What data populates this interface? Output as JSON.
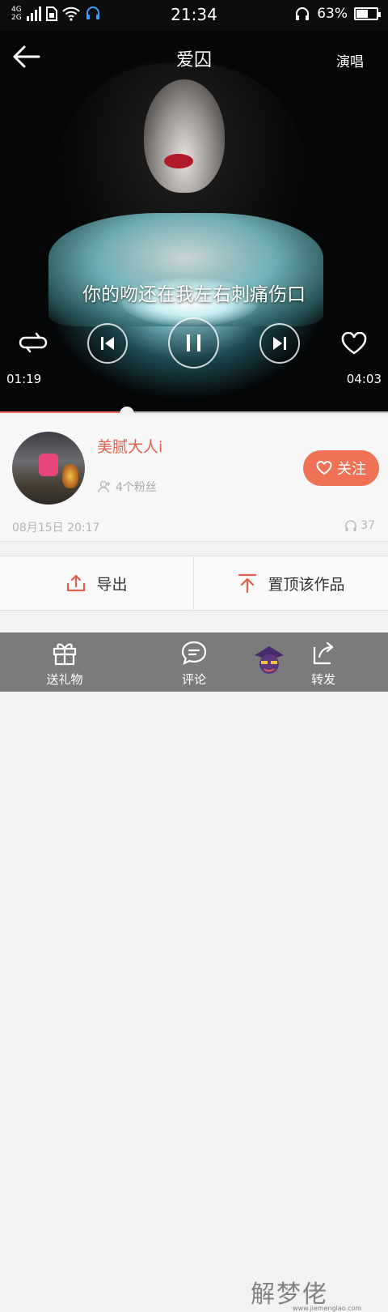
{
  "status_bar": {
    "network_top": "4G",
    "network_bottom": "2G",
    "time": "21:34",
    "battery": "63%",
    "battery_level": 0.63
  },
  "header": {
    "title": "爱囚",
    "singer_button": "演唱"
  },
  "player": {
    "lyric": "你的吻还在我左右刺痛伤口",
    "current_time": "01:19",
    "total_time": "04:03",
    "progress": 0.327,
    "accent_color": "#ef6f55"
  },
  "profile": {
    "username": "美腻大人i",
    "fans": "4个粉丝",
    "follow_label": "关注",
    "date": "08月15日 20:17",
    "listen_count": "37"
  },
  "actions": {
    "export_label": "导出",
    "pin_label": "置顶该作品"
  },
  "bottom_nav": [
    {
      "label": "送礼物",
      "icon": "gift-icon"
    },
    {
      "label": "评论",
      "icon": "comment-icon"
    },
    {
      "label": "",
      "icon": "avatar-icon"
    },
    {
      "label": "转发",
      "icon": "share-icon"
    }
  ],
  "watermark": {
    "text": "解梦佬",
    "url": "www.jiemenglao.com"
  }
}
